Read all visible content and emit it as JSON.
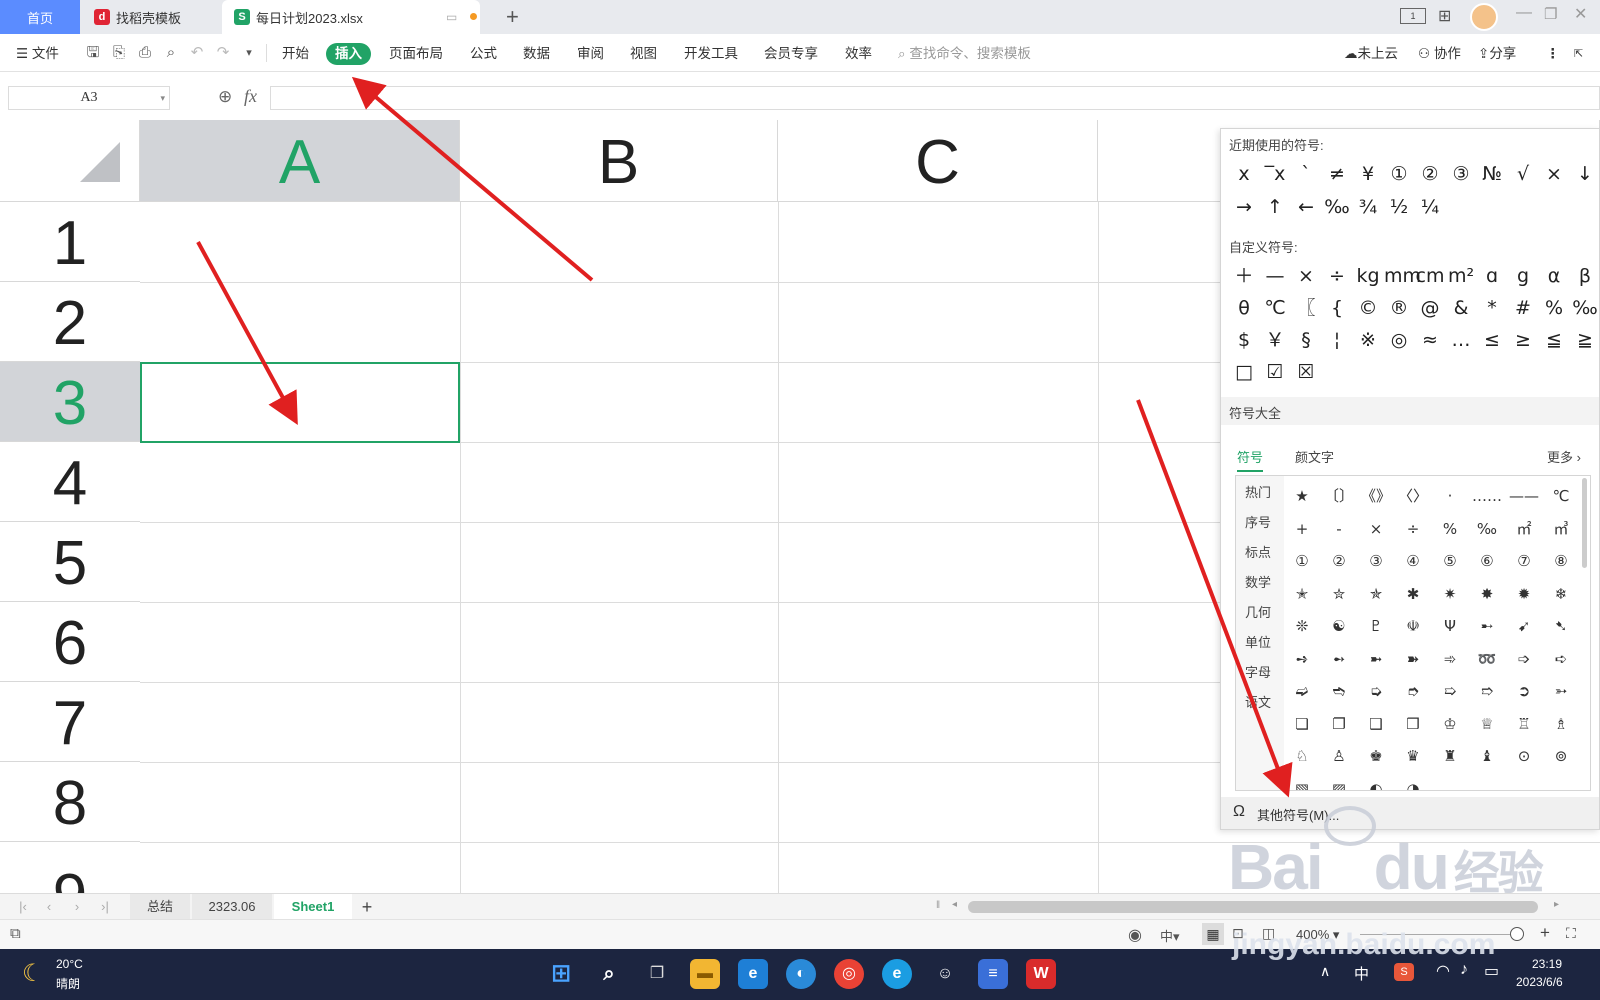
{
  "tabs": {
    "home": "首页",
    "template": "找稻壳模板",
    "active_file": "每日计划2023.xlsx"
  },
  "menu": {
    "file": "文件",
    "items": [
      "开始",
      "插入",
      "页面布局",
      "公式",
      "数据",
      "审阅",
      "视图",
      "开发工具",
      "会员专享",
      "效率"
    ],
    "active": "插入",
    "search_placeholder": "查找命令、搜索模板",
    "cloud": "未上云",
    "collab": "协作",
    "share": "分享"
  },
  "formula_bar": {
    "name_box": "A3",
    "fx": "fx",
    "value": ""
  },
  "sheet": {
    "columns": [
      "A",
      "B",
      "C"
    ],
    "rows": [
      "1",
      "2",
      "3",
      "4",
      "5",
      "6",
      "7",
      "8",
      "9"
    ],
    "selected_cell": "A3"
  },
  "symbol_panel": {
    "recent_label": "近期使用的符号:",
    "recent_symbols": [
      "x",
      "‾x",
      "`",
      "≠",
      "¥",
      "①",
      "②",
      "③",
      "№",
      "√",
      "×",
      "↓",
      "→",
      "↑",
      "←",
      "‰",
      "¾",
      "½",
      "¼"
    ],
    "custom_label": "自定义符号:",
    "custom_symbols": [
      "＋",
      "—",
      "×",
      "÷",
      "kg",
      "mm",
      "cm",
      "m²",
      "ɑ",
      "g",
      "α",
      "β",
      "θ",
      "℃",
      "〖",
      "{",
      "©",
      "®",
      "@",
      "&",
      "*",
      "#",
      "%",
      "‰",
      "$",
      "￥",
      "§",
      "¦",
      "※",
      "◎",
      "≈",
      "…",
      "≤",
      "≥",
      "≦",
      "≧",
      "□",
      "☑",
      "☒"
    ],
    "all_label": "符号大全",
    "tab_symbols": "符号",
    "tab_kaomoji": "颜文字",
    "more": "更多",
    "categories": [
      "热门",
      "序号",
      "标点",
      "数学",
      "几何",
      "单位",
      "字母",
      "语文"
    ],
    "grid_symbols": [
      "★",
      "〔〕",
      "《》",
      "〈〉",
      "·",
      "……",
      "——",
      "℃",
      "+",
      "-",
      "×",
      "÷",
      "%",
      "‰",
      "㎡",
      "㎥",
      "①",
      "②",
      "③",
      "④",
      "⑤",
      "⑥",
      "⑦",
      "⑧",
      "✭",
      "✮",
      "✯",
      "✱",
      "✷",
      "✸",
      "✹",
      "❄",
      "❊",
      "☯",
      "♇",
      "☫",
      "Ψ",
      "➸",
      "➹",
      "➷",
      "➺",
      "➻",
      "➼",
      "➽",
      "➾",
      "➿",
      "➩",
      "➪",
      "➫",
      "➬",
      "➭",
      "➮",
      "➯",
      "➱",
      "➲",
      "➳",
      "❏",
      "❐",
      "❑",
      "❒",
      "♔",
      "♕",
      "♖",
      "♗",
      "♘",
      "♙",
      "♚",
      "♛",
      "♜",
      "♝",
      "⊙",
      "⊚",
      "▧",
      "▨",
      "◐",
      "◑"
    ],
    "footer": "其他符号(M)..."
  },
  "sheet_tabs": [
    "总结",
    "2323.06",
    "Sheet1"
  ],
  "active_sheet": "Sheet1",
  "status": {
    "zoom": "400%",
    "input_mode": "中"
  },
  "taskbar": {
    "temp": "20°C",
    "weather": "晴朗",
    "time": "23:19",
    "date": "2023/6/6",
    "ime": "中"
  },
  "watermark": {
    "brand": "Bai",
    "brand2": "du",
    "jingyan": "经验",
    "url": "jingyan.baidu.com"
  },
  "colors": {
    "accent": "#21a366",
    "arrow": "#e02020",
    "home_tab": "#5b8cff"
  }
}
